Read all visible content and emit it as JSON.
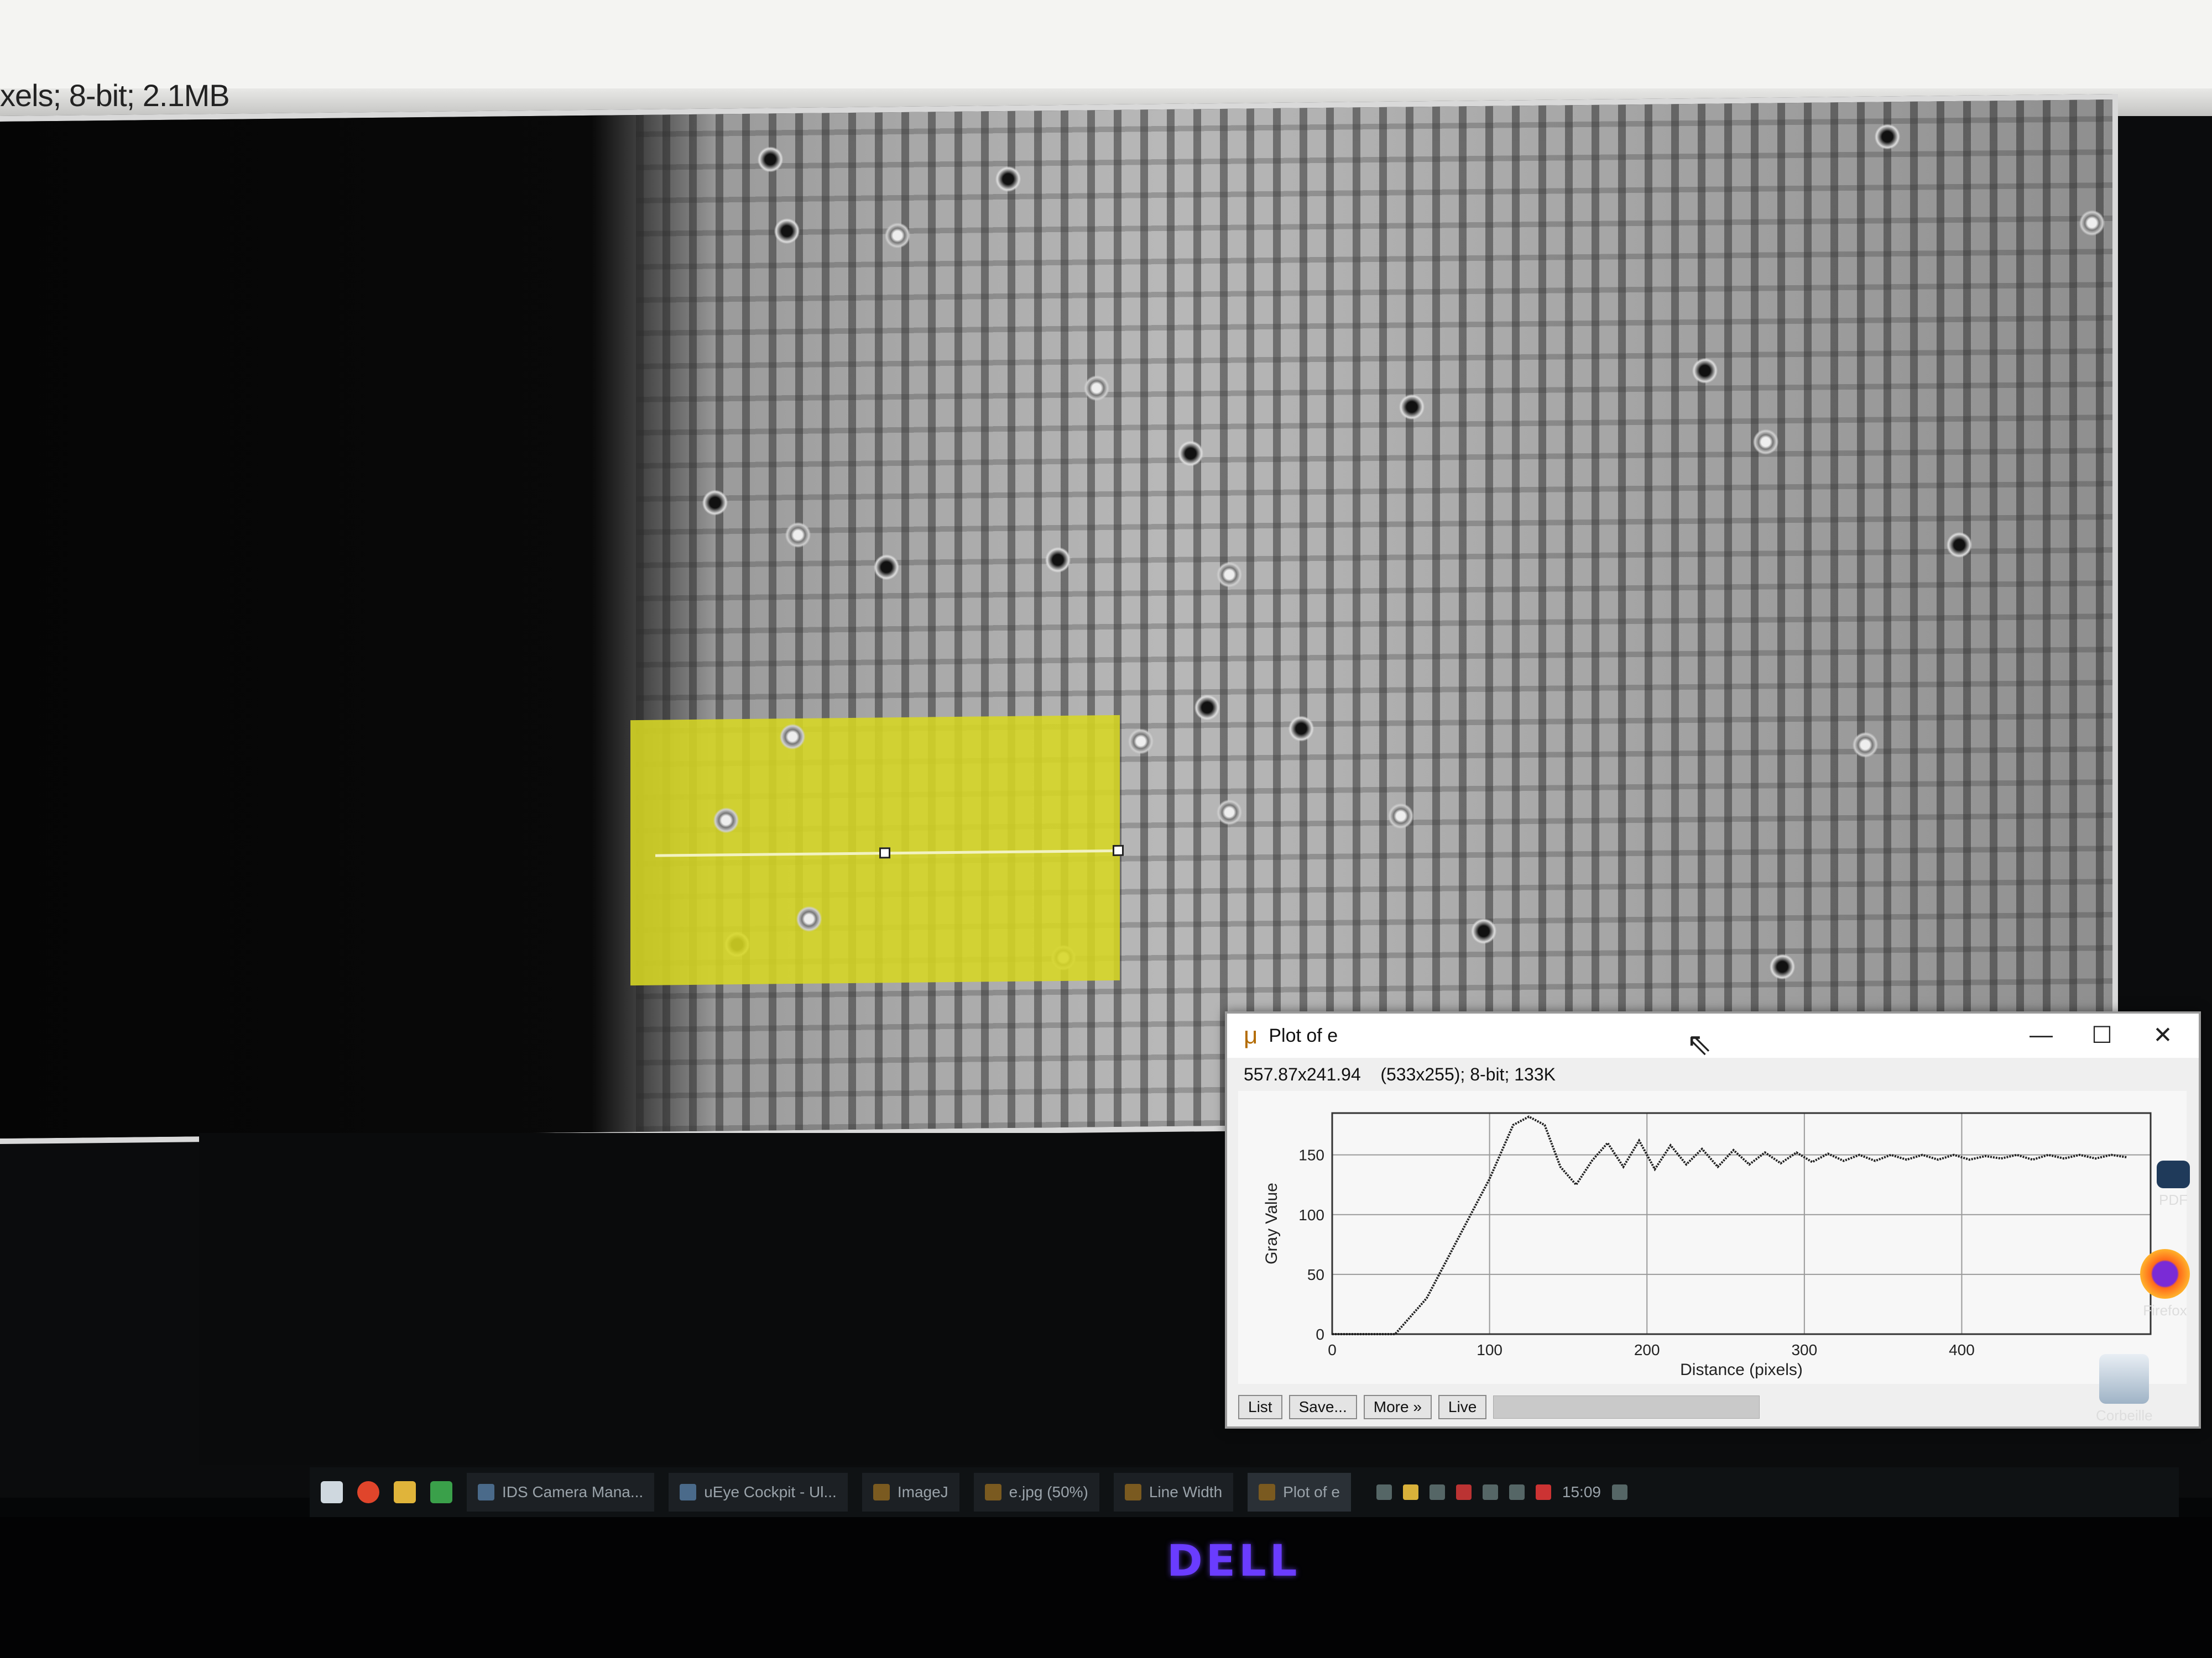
{
  "image_window": {
    "info_line": "xels; 8-bit; 2.1MB"
  },
  "plot_window": {
    "title": "Plot of e",
    "info": "557.87x241.94    (533x255); 8-bit; 133K",
    "controls": {
      "minimize": "—",
      "maximize": "☐",
      "close": "✕"
    },
    "buttons": [
      "List",
      "Save...",
      "More »",
      "Live"
    ]
  },
  "chart_data": {
    "type": "line",
    "xlabel": "Distance (pixels)",
    "ylabel": "Gray Value",
    "xlim": [
      0,
      520
    ],
    "ylim": [
      0,
      185
    ],
    "x_ticks": [
      "0",
      "100",
      "200",
      "300",
      "400"
    ],
    "x_tick_values": [
      0,
      100,
      200,
      300,
      400
    ],
    "y_ticks": [
      "0",
      "50",
      "100",
      "150"
    ],
    "y_tick_values": [
      0,
      50,
      100,
      150
    ],
    "grid": true,
    "series": [
      {
        "x": [
          0,
          20,
          40,
          60,
          80,
          100,
          115,
          125,
          135,
          145,
          155,
          165,
          175,
          185,
          195,
          205,
          215,
          225,
          235,
          245,
          255,
          265,
          275,
          285,
          295,
          305,
          315,
          325,
          335,
          345,
          355,
          365,
          375,
          385,
          395,
          405,
          415,
          425,
          435,
          445,
          455,
          465,
          475,
          485,
          495,
          505
        ],
        "y": [
          0,
          0,
          0,
          30,
          80,
          130,
          175,
          182,
          175,
          140,
          125,
          145,
          160,
          140,
          162,
          138,
          158,
          142,
          155,
          140,
          154,
          142,
          152,
          143,
          152,
          144,
          151,
          145,
          150,
          145,
          150,
          146,
          150,
          146,
          150,
          146,
          149,
          147,
          150,
          146,
          150,
          147,
          150,
          147,
          150,
          148
        ]
      }
    ]
  },
  "desktop_icons": [
    "PDF",
    "Firefox",
    "Corbeille"
  ],
  "taskbar": {
    "items": [
      "IDS Camera Mana...",
      "uEye Cockpit - Ul...",
      "ImageJ",
      "e.jpg (50%)",
      "Line Width",
      "Plot of e"
    ],
    "clock": "15:09"
  },
  "brand": "DELL"
}
